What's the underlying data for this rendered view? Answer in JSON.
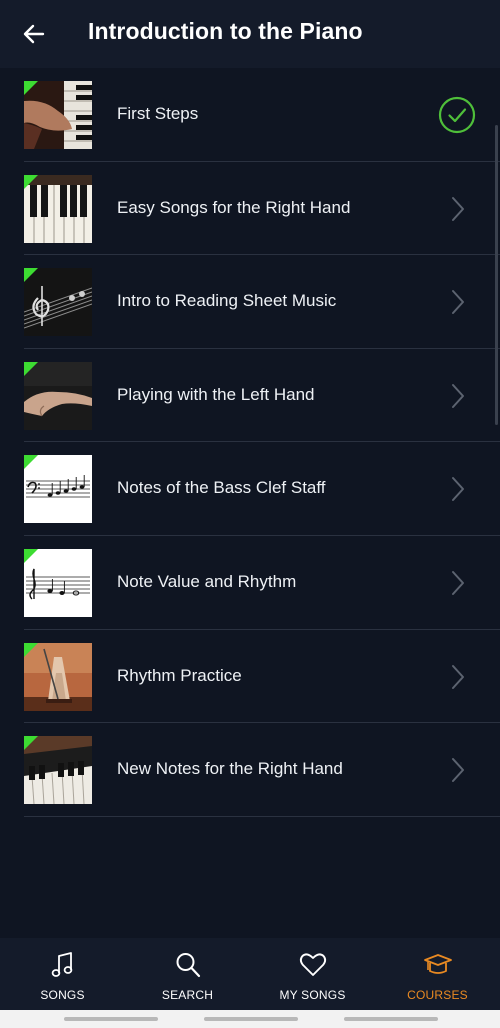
{
  "header": {
    "back_icon": "arrow-left-icon",
    "title": "Introduction to the Piano"
  },
  "lessons": [
    {
      "label": "First Steps",
      "status": "completed",
      "thumb": "hands-on-piano",
      "status_icon": "check-circle-icon"
    },
    {
      "label": "Easy Songs for the Right Hand",
      "status": "available",
      "thumb": "piano-keys",
      "status_icon": "chevron-right-icon"
    },
    {
      "label": "Intro to Reading Sheet Music",
      "status": "available",
      "thumb": "sheet-music-clef",
      "status_icon": "chevron-right-icon"
    },
    {
      "label": "Playing with the Left Hand",
      "status": "available",
      "thumb": "left-hand",
      "status_icon": "chevron-right-icon"
    },
    {
      "label": "Notes of the Bass Clef Staff",
      "status": "available",
      "thumb": "bass-clef-staff",
      "status_icon": "chevron-right-icon"
    },
    {
      "label": "Note Value and Rhythm",
      "status": "available",
      "thumb": "treble-staff-notes",
      "status_icon": "chevron-right-icon"
    },
    {
      "label": "Rhythm Practice",
      "status": "available",
      "thumb": "metronome",
      "status_icon": "chevron-right-icon"
    },
    {
      "label": "New Notes for the Right Hand",
      "status": "available",
      "thumb": "piano-keys-angled",
      "status_icon": "chevron-right-icon"
    }
  ],
  "bottom_nav": [
    {
      "label": "SONGS",
      "icon": "music-note-icon",
      "active": false
    },
    {
      "label": "SEARCH",
      "icon": "search-icon",
      "active": false
    },
    {
      "label": "MY SONGS",
      "icon": "heart-icon",
      "active": false
    },
    {
      "label": "COURSES",
      "icon": "graduation-cap-icon",
      "active": true
    }
  ],
  "colors": {
    "background": "#0f1522",
    "bar": "#141b2a",
    "accent_green": "#3ddc32",
    "check_green": "#4fbf3a",
    "active_orange": "#e98a22"
  }
}
